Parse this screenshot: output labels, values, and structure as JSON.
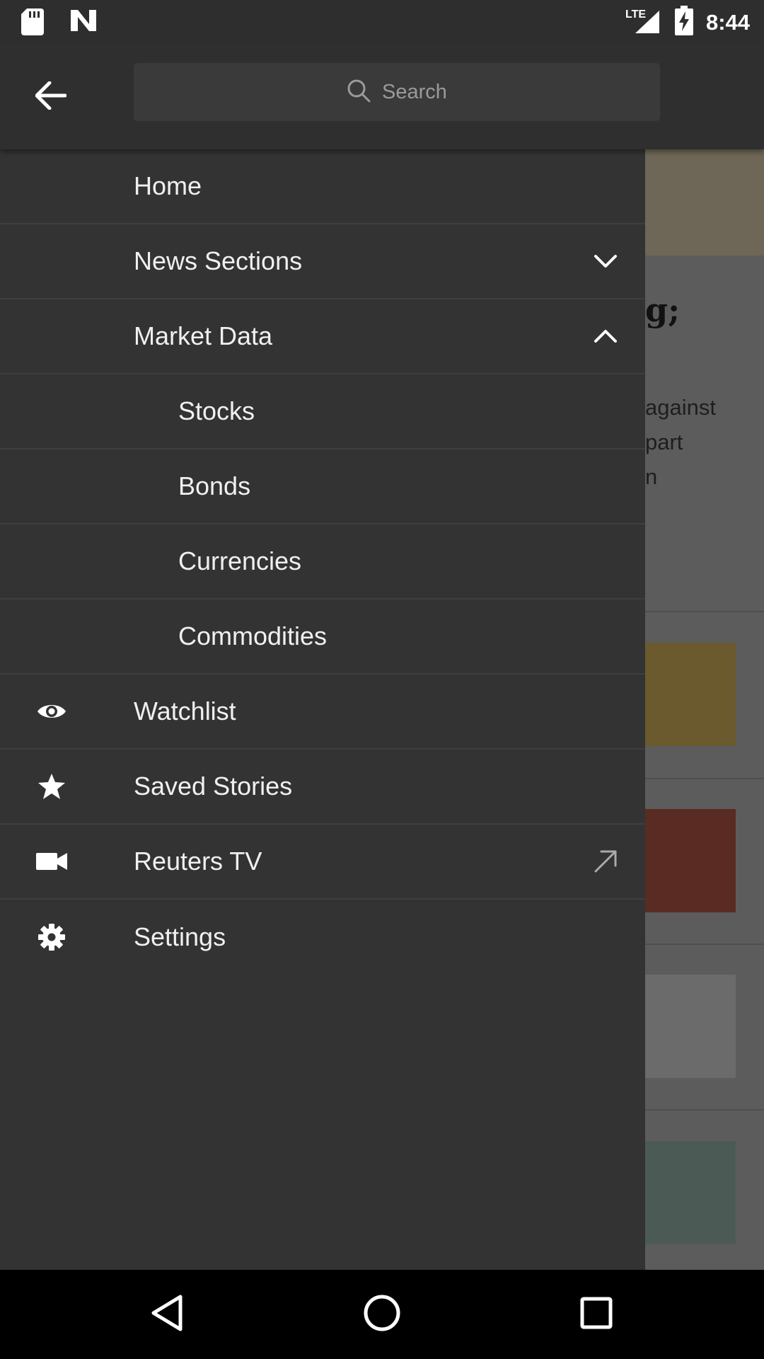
{
  "status_bar": {
    "time": "8:44",
    "network": "LTE",
    "icons": [
      "sd-card-icon",
      "n-app-icon",
      "lte-signal-icon",
      "battery-charging-icon"
    ]
  },
  "header": {
    "back_icon": "arrow-back-icon",
    "search": {
      "placeholder": "Search",
      "icon": "search-icon"
    }
  },
  "drawer": {
    "items": [
      {
        "label": "Home"
      },
      {
        "label": "News Sections",
        "right_icon": "chevron-down-icon"
      },
      {
        "label": "Market Data",
        "right_icon": "chevron-up-icon"
      },
      {
        "label": "Stocks",
        "sub": true
      },
      {
        "label": "Bonds",
        "sub": true
      },
      {
        "label": "Currencies",
        "sub": true
      },
      {
        "label": "Commodities",
        "sub": true
      },
      {
        "label": "Watchlist",
        "icon": "eye-icon"
      },
      {
        "label": "Saved Stories",
        "icon": "star-icon"
      },
      {
        "label": "Reuters TV",
        "icon": "video-camera-icon",
        "right_icon": "external-link-arrow-icon"
      },
      {
        "label": "Settings",
        "icon": "gear-icon"
      }
    ]
  },
  "background_content": {
    "headline_fragment": "g;",
    "text_fragments": [
      "against",
      "part",
      "n"
    ]
  },
  "nav_bar": {
    "buttons": [
      "back-triangle-icon",
      "home-circle-icon",
      "recents-square-icon"
    ]
  },
  "colors": {
    "drawer_bg": "#333333",
    "header_bg": "#2f2f2f",
    "search_bg": "#3a3a3a",
    "divider": "#3f3f3f",
    "text": "#f0f0f0"
  }
}
